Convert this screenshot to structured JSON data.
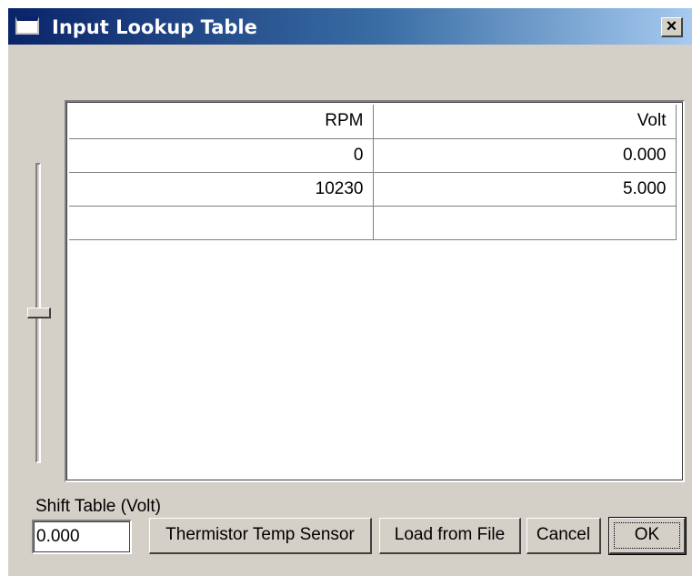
{
  "window": {
    "title": "Input Lookup Table",
    "close_glyph": "×",
    "icon": "window-icon"
  },
  "table": {
    "headers": [
      "RPM",
      "Volt"
    ],
    "rows": [
      [
        "0",
        "0.000"
      ],
      [
        "10230",
        "5.000"
      ],
      [
        "",
        ""
      ]
    ]
  },
  "slider": {
    "value_fraction": 0.5
  },
  "shift": {
    "label": "Shift Table (Volt)",
    "value": "0.000"
  },
  "buttons": {
    "thermistor": "Thermistor Temp Sensor",
    "load": "Load from File",
    "cancel": "Cancel",
    "ok": "OK"
  }
}
